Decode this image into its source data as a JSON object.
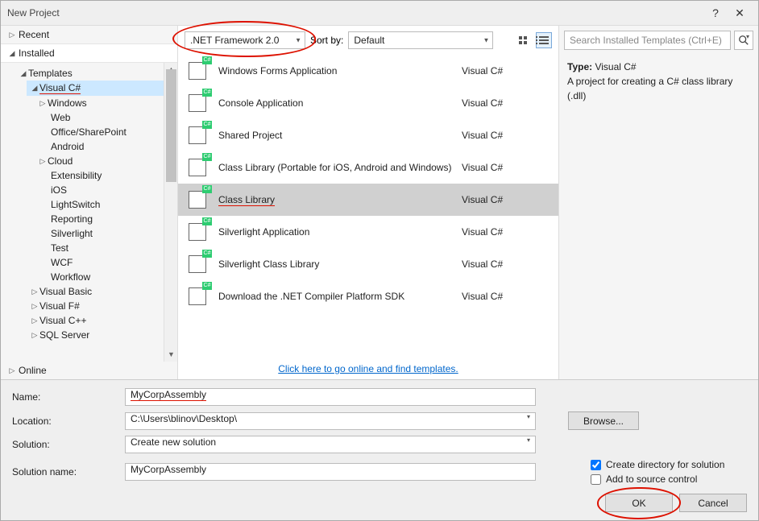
{
  "window": {
    "title": "New Project",
    "help": "?",
    "close": "✕"
  },
  "left": {
    "recent": "Recent",
    "installed": "Installed",
    "templates": "Templates",
    "csharp": "Visual C#",
    "children": [
      "Windows",
      "Web",
      "Office/SharePoint",
      "Android",
      "Cloud",
      "Extensibility",
      "iOS",
      "LightSwitch",
      "Reporting",
      "Silverlight",
      "Test",
      "WCF",
      "Workflow"
    ],
    "after": [
      "Visual Basic",
      "Visual F#",
      "Visual C++",
      "SQL Server"
    ],
    "online": "Online"
  },
  "toolbar": {
    "framework": ".NET Framework 2.0",
    "sortby_label": "Sort by:",
    "sortby_value": "Default"
  },
  "templates": [
    {
      "name": "Windows Forms Application",
      "lang": "Visual C#"
    },
    {
      "name": "Console Application",
      "lang": "Visual C#"
    },
    {
      "name": "Shared Project",
      "lang": "Visual C#"
    },
    {
      "name": "Class Library (Portable for iOS, Android and Windows)",
      "lang": "Visual C#"
    },
    {
      "name": "Class Library",
      "lang": "Visual C#"
    },
    {
      "name": "Silverlight Application",
      "lang": "Visual C#"
    },
    {
      "name": "Silverlight Class Library",
      "lang": "Visual C#"
    },
    {
      "name": "Download the .NET Compiler Platform SDK",
      "lang": "Visual C#"
    }
  ],
  "selected_template_index": 4,
  "golink": "Click here to go online and find templates.",
  "right": {
    "search_placeholder": "Search Installed Templates (Ctrl+E)",
    "type_label": "Type:",
    "type_value": "Visual C#",
    "desc": "A project for creating a C# class library (.dll)"
  },
  "form": {
    "name_label": "Name:",
    "name_value": "MyCorpAssembly",
    "location_label": "Location:",
    "location_value": "C:\\Users\\blinov\\Desktop\\",
    "solution_label": "Solution:",
    "solution_value": "Create new solution",
    "solution_name_label": "Solution name:",
    "solution_name_value": "MyCorpAssembly",
    "browse": "Browse...",
    "create_dir": "Create directory for solution",
    "add_scm": "Add to source control",
    "create_dir_checked": true,
    "add_scm_checked": false,
    "ok": "OK",
    "cancel": "Cancel"
  }
}
